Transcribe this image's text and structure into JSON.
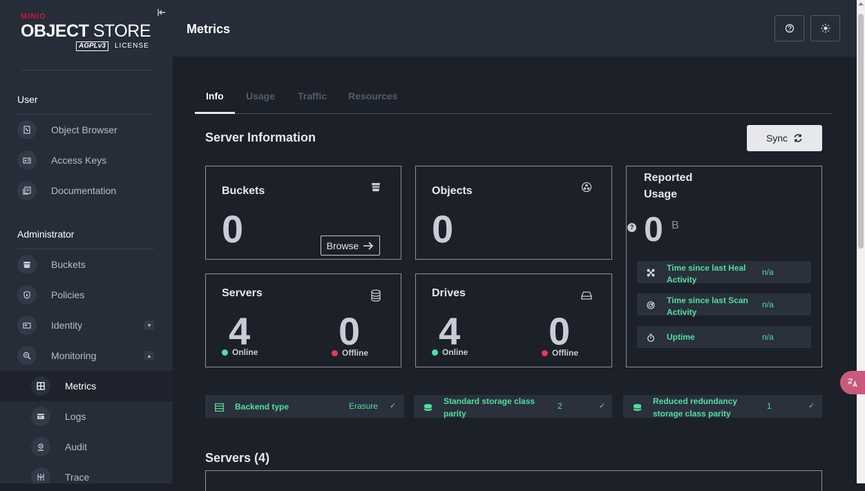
{
  "sidebar": {
    "logo": {
      "top": "MINIO",
      "brand_bold": "OBJECT",
      "brand_light": " STORE",
      "agpl": "AGPLv3",
      "license": "LICENSE"
    },
    "sections": [
      {
        "title": "User",
        "items": [
          {
            "label": "Object Browser",
            "icon": "object-browser-icon"
          },
          {
            "label": "Access Keys",
            "icon": "access-keys-icon"
          },
          {
            "label": "Documentation",
            "icon": "documentation-icon"
          }
        ]
      },
      {
        "title": "Administrator",
        "items": [
          {
            "label": "Buckets",
            "icon": "bucket-icon"
          },
          {
            "label": "Policies",
            "icon": "policy-icon"
          },
          {
            "label": "Identity",
            "icon": "identity-icon"
          },
          {
            "label": "Monitoring",
            "icon": "monitoring-icon"
          },
          {
            "label": "Metrics",
            "icon": "metrics-icon"
          },
          {
            "label": "Logs",
            "icon": "logs-icon"
          },
          {
            "label": "Audit",
            "icon": "audit-icon"
          },
          {
            "label": "Trace",
            "icon": "trace-icon"
          }
        ]
      }
    ]
  },
  "header": {
    "title": "Metrics"
  },
  "tabs": [
    {
      "label": "Info"
    },
    {
      "label": "Usage"
    },
    {
      "label": "Traffic"
    },
    {
      "label": "Resources"
    }
  ],
  "server_info": {
    "title": "Server Information",
    "sync_label": "Sync",
    "buckets": {
      "title": "Buckets",
      "value": "0",
      "browse_label": "Browse"
    },
    "objects": {
      "title": "Objects",
      "value": "0"
    },
    "servers": {
      "title": "Servers",
      "online": "4",
      "offline": "0",
      "online_label": "Online",
      "offline_label": "Offline"
    },
    "drives": {
      "title": "Drives",
      "online": "4",
      "offline": "0",
      "online_label": "Online",
      "offline_label": "Offline"
    },
    "reported": {
      "title": "Reported Usage",
      "value": "0",
      "unit": "B",
      "rows": [
        {
          "label": "Time since last Heal Activity",
          "value": "n/a"
        },
        {
          "label": "Time since last Scan Activity",
          "value": "n/a"
        },
        {
          "label": "Uptime",
          "value": "n/a"
        }
      ]
    }
  },
  "strips": [
    {
      "label": "Backend type",
      "value": "Erasure"
    },
    {
      "label": "Standard storage class parity",
      "value": "2"
    },
    {
      "label": "Reduced redundancy storage class parity",
      "value": "1"
    }
  ],
  "servers_section": {
    "title": "Servers (4)"
  },
  "colors": {
    "online": "#4fe0a0",
    "offline": "#f0345a",
    "accent_green": "#4fe0a0",
    "bg": "#1c2029",
    "sidebar": "#262c38"
  }
}
